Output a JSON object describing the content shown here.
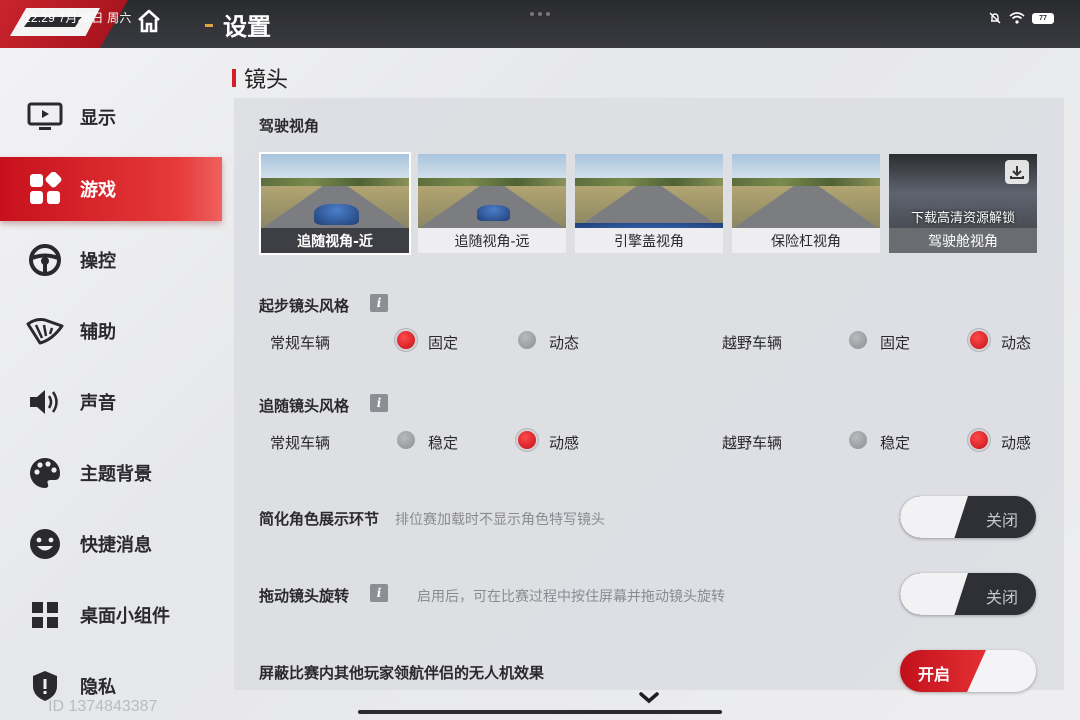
{
  "status_bar": {
    "time": "12:29 7月25日 周六",
    "battery": "77"
  },
  "header": {
    "title": "设置"
  },
  "sidebar": {
    "items": [
      {
        "label": "显示",
        "icon": "monitor-icon",
        "active": false
      },
      {
        "label": "游戏",
        "icon": "grid-game-icon",
        "active": true
      },
      {
        "label": "操控",
        "icon": "steering-wheel-icon",
        "active": false
      },
      {
        "label": "辅助",
        "icon": "assist-icon",
        "active": false
      },
      {
        "label": "声音",
        "icon": "speaker-icon",
        "active": false
      },
      {
        "label": "主题背景",
        "icon": "palette-icon",
        "active": false
      },
      {
        "label": "快捷消息",
        "icon": "smiley-icon",
        "active": false
      },
      {
        "label": "桌面小组件",
        "icon": "widgets-icon",
        "active": false
      },
      {
        "label": "隐私",
        "icon": "shield-icon",
        "active": false
      }
    ],
    "user_id": "ID 1374843387"
  },
  "section": {
    "title": "镜头"
  },
  "driving_view": {
    "label": "驾驶视角",
    "options": [
      {
        "caption": "追随视角-近",
        "selected": true
      },
      {
        "caption": "追随视角-远",
        "selected": false
      },
      {
        "caption": "引擎盖视角",
        "selected": false
      },
      {
        "caption": "保险杠视角",
        "selected": false
      },
      {
        "caption": "驾驶舱视角",
        "selected": false,
        "locked_text": "下载高清资源解锁"
      }
    ]
  },
  "start_camera": {
    "label": "起步镜头风格",
    "regular": {
      "label": "常规车辆",
      "opt1": "固定",
      "opt2": "动态",
      "selected": "固定"
    },
    "offroad": {
      "label": "越野车辆",
      "opt1": "固定",
      "opt2": "动态",
      "selected": "动态"
    }
  },
  "follow_camera": {
    "label": "追随镜头风格",
    "regular": {
      "label": "常规车辆",
      "opt1": "稳定",
      "opt2": "动感",
      "selected": "动感"
    },
    "offroad": {
      "label": "越野车辆",
      "opt1": "稳定",
      "opt2": "动感",
      "selected": "动感"
    }
  },
  "simplify_intro": {
    "label": "简化角色展示环节",
    "hint": "排位赛加载时不显示角色特写镜头",
    "toggle": "关闭"
  },
  "drag_rotate": {
    "label": "拖动镜头旋转",
    "hint": "启用后，可在比赛过程中按住屏幕并拖动镜头旋转",
    "toggle": "关闭"
  },
  "hide_drone": {
    "label": "屏蔽比赛内其他玩家领航伴侣的无人机效果",
    "toggle": "开启"
  },
  "colors": {
    "accent": "#d41f2a",
    "topbar": "#2a2b2f"
  }
}
